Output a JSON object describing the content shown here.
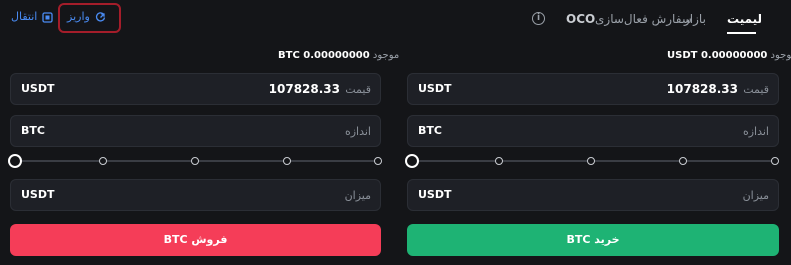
{
  "tabs": {
    "limit": "لیمیت",
    "market": "بازار",
    "stop_order": "سفارش فعال‌سازی",
    "oco": "OCO"
  },
  "top_links": {
    "deposit": "واریز",
    "transfer": "انتقال"
  },
  "buy": {
    "available_label": "موجود",
    "available_value": "0.00000000 USDT",
    "price_label": "قیمت",
    "price_value": "107828.33",
    "price_unit": "USDT",
    "amount_label": "اندازه",
    "amount_unit": "BTC",
    "total_label": "میزان",
    "total_unit": "USDT",
    "button_label": "خرید BTC",
    "slider_value_percent": 0
  },
  "sell": {
    "available_label": "موجود",
    "available_value": "0.00000000 BTC",
    "price_label": "قیمت",
    "price_value": "107828.33",
    "price_unit": "USDT",
    "amount_label": "اندازه",
    "amount_unit": "BTC",
    "total_label": "میزان",
    "total_unit": "USDT",
    "button_label": "فروش BTC",
    "slider_value_percent": 0
  },
  "colors": {
    "buy": "#1eb374",
    "sell": "#f53d58",
    "link": "#4a8cf4",
    "highlight_box": "#a41d2a"
  },
  "icons": {
    "deposit": "deposit-icon",
    "transfer": "transfer-icon",
    "info": "info-icon"
  }
}
